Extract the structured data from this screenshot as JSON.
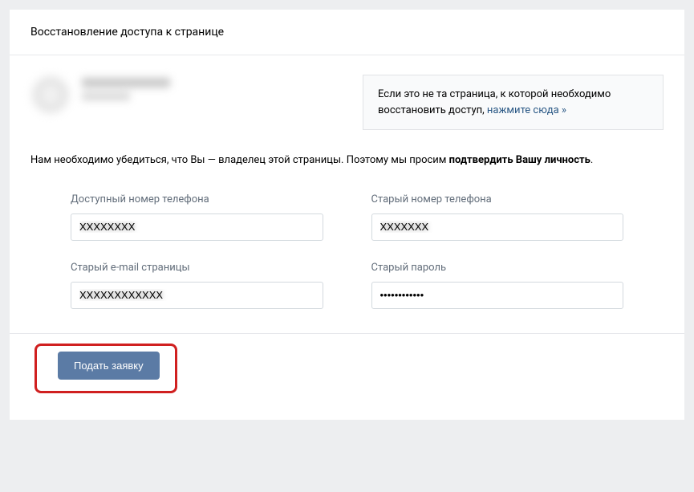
{
  "header": {
    "title": "Восстановление доступа к странице"
  },
  "notice": {
    "text_before": "Если это не та страница, к которой необходимо восстановить доступ, ",
    "link_text": "нажмите сюда »"
  },
  "instruction": {
    "text_before": "Нам необходимо убедиться, что Вы — владелец этой страницы. Поэтому мы просим ",
    "text_bold": "подтвердить Вашу личность",
    "text_after": "."
  },
  "fields": {
    "available_phone": {
      "label": "Доступный номер телефона",
      "value": "XXXXXXXX"
    },
    "old_phone": {
      "label": "Старый номер телефона",
      "value": "XXXXXXX"
    },
    "old_email": {
      "label": "Старый e-mail страницы",
      "value": "XXXXXXXXXXXX"
    },
    "old_password": {
      "label": "Старый пароль",
      "value": "••••••••••••"
    }
  },
  "submit": {
    "label": "Подать заявку"
  }
}
